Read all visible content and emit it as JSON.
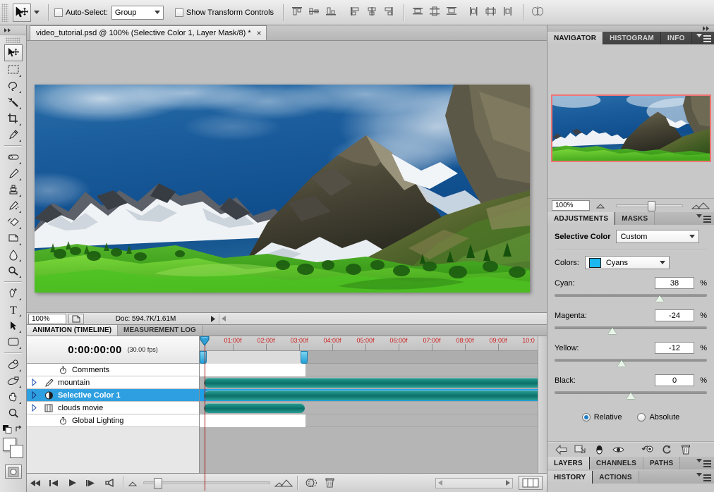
{
  "options_bar": {
    "auto_select_label": "Auto-Select:",
    "auto_select_value": "Group",
    "show_transform_label": "Show Transform Controls",
    "tool_icon": "move-tool-icon"
  },
  "tools": [
    {
      "name": "move-tool",
      "selected": true
    },
    {
      "name": "rectangular-marquee-tool",
      "selected": false
    },
    {
      "name": "lasso-tool",
      "selected": false
    },
    {
      "name": "magic-wand-tool",
      "selected": false
    },
    {
      "name": "crop-tool",
      "selected": false
    },
    {
      "name": "eyedropper-tool",
      "selected": false
    },
    {
      "name": "spot-healing-brush-tool",
      "selected": false
    },
    {
      "name": "brush-tool",
      "selected": false
    },
    {
      "name": "clone-stamp-tool",
      "selected": false
    },
    {
      "name": "history-brush-tool",
      "selected": false
    },
    {
      "name": "eraser-tool",
      "selected": false
    },
    {
      "name": "gradient-tool",
      "selected": false
    },
    {
      "name": "blur-tool",
      "selected": false
    },
    {
      "name": "dodge-tool",
      "selected": false
    },
    {
      "name": "pen-tool",
      "selected": false
    },
    {
      "name": "horizontal-type-tool",
      "selected": false
    },
    {
      "name": "path-selection-tool",
      "selected": false
    },
    {
      "name": "rounded-rectangle-tool",
      "selected": false
    },
    {
      "name": "3d-rotate-tool",
      "selected": false
    },
    {
      "name": "3d-orbit-camera-tool",
      "selected": false
    },
    {
      "name": "hand-tool",
      "selected": false
    },
    {
      "name": "zoom-tool",
      "selected": false
    }
  ],
  "document": {
    "tab_title": "video_tutorial.psd @ 100% (Selective Color 1, Layer Mask/8) *",
    "close_label": "×",
    "zoom_level": "100%",
    "doc_info": "Doc: 594.7K/1.61M"
  },
  "animation": {
    "tabs": [
      {
        "label": "ANIMATION (TIMELINE)",
        "active": true
      },
      {
        "label": "MEASUREMENT LOG",
        "active": false
      }
    ],
    "timecode": "0:00:00:00",
    "fps": "(30.00 fps)",
    "tracks": [
      {
        "label": "Comments",
        "icon": "stopwatch-icon",
        "twisty": false,
        "selected": false,
        "bar": null
      },
      {
        "label": "mountain",
        "icon": "brush-layer-icon",
        "twisty": true,
        "selected": false,
        "bar": "full"
      },
      {
        "label": "Selective Color 1",
        "icon": "adjustment-layer-icon",
        "twisty": true,
        "selected": true,
        "bar": "full"
      },
      {
        "label": "clouds movie",
        "icon": "video-layer-icon",
        "twisty": true,
        "selected": false,
        "bar": "short"
      },
      {
        "label": "Global Lighting",
        "icon": "stopwatch-icon",
        "twisty": false,
        "selected": false,
        "bar": null
      }
    ],
    "ruler_labels": [
      "01:00f",
      "02:00f",
      "03:00f",
      "04:00f",
      "05:00f",
      "06:00f",
      "07:00f",
      "08:00f",
      "09:00f",
      "10:0"
    ],
    "work_area_end": "03:00f"
  },
  "transport": {
    "buttons": [
      "rewind-to-start-icon",
      "step-back-icon",
      "play-icon",
      "step-forward-icon",
      "audio-mute-icon"
    ],
    "right_buttons": [
      "onion-skin-icon",
      "delete-keyframes-icon"
    ],
    "convert_frames_icon": "convert-to-frame-animation-icon"
  },
  "navigator_panel": {
    "tabs": [
      {
        "label": "NAVIGATOR",
        "active": true
      },
      {
        "label": "HISTOGRAM",
        "active": false
      },
      {
        "label": "INFO",
        "active": false
      }
    ],
    "zoom_value": "100%"
  },
  "adjustments_panel": {
    "tabs": [
      {
        "label": "ADJUSTMENTS",
        "active": true
      },
      {
        "label": "MASKS",
        "active": false
      }
    ],
    "title": "Selective Color",
    "preset": "Custom",
    "colors_label": "Colors:",
    "colors_value": "Cyans",
    "colors_swatch": "#1bb8ef",
    "sliders": [
      {
        "label": "Cyan:",
        "value": "38",
        "unit": "%",
        "pos_pct": 69
      },
      {
        "label": "Magenta:",
        "value": "-24",
        "unit": "%",
        "pos_pct": 38
      },
      {
        "label": "Yellow:",
        "value": "-12",
        "unit": "%",
        "pos_pct": 44
      },
      {
        "label": "Black:",
        "value": "0",
        "unit": "%",
        "pos_pct": 50
      }
    ],
    "method_options": [
      {
        "label": "Relative",
        "selected": true
      },
      {
        "label": "Absolute",
        "selected": false
      }
    ],
    "footer_icons": [
      "return-to-adjustment-list-icon",
      "clip-to-layer-icon",
      "toggle-layer-visibility-icon",
      "preview-eye-icon",
      "view-previous-state-icon",
      "reset-adjustment-icon",
      "delete-adjustment-layer-icon"
    ]
  },
  "layers_panel": {
    "tabs": [
      {
        "label": "LAYERS",
        "active": true
      },
      {
        "label": "CHANNELS",
        "active": false
      },
      {
        "label": "PATHS",
        "active": false
      }
    ]
  },
  "history_panel": {
    "tabs": [
      {
        "label": "HISTORY",
        "active": true
      },
      {
        "label": "ACTIONS",
        "active": false
      }
    ]
  }
}
